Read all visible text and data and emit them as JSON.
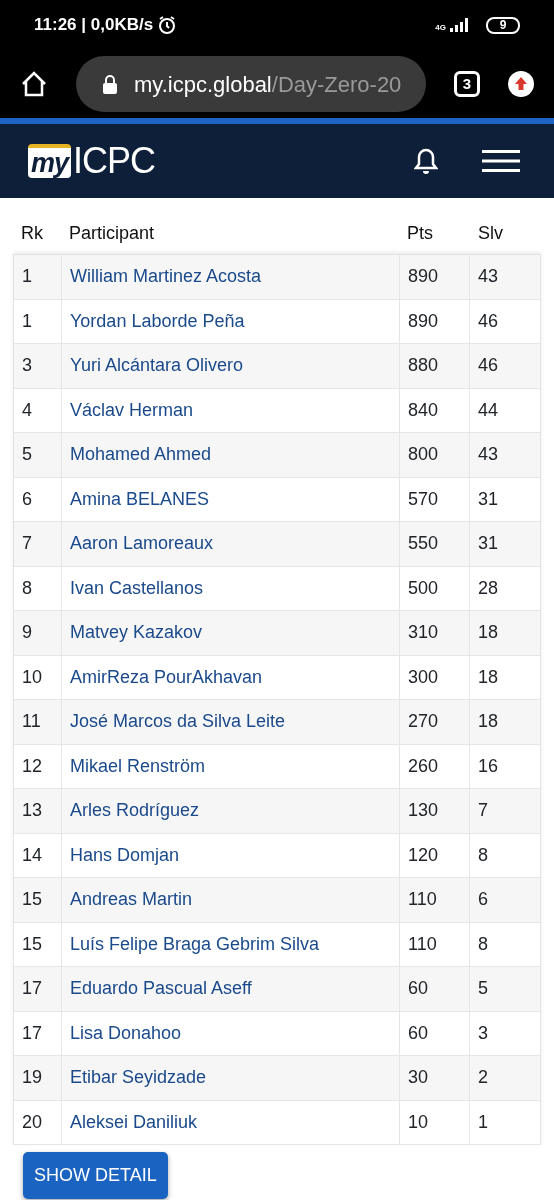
{
  "status_bar": {
    "time": "11:26",
    "separator": "|",
    "speed": "0,0KB/s",
    "network": "4G",
    "battery": "9"
  },
  "browser": {
    "url_host": "my.icpc.global",
    "url_path": "/Day-Zero-20",
    "tab_count": "3"
  },
  "header": {
    "logo_my": "my",
    "logo_text": "ICPC"
  },
  "table": {
    "columns": [
      "Rk",
      "Participant",
      "Pts",
      "Slv"
    ],
    "rows": [
      {
        "rank": "1",
        "participant": "William Martinez Acosta",
        "pts": "890",
        "slv": "43"
      },
      {
        "rank": "1",
        "participant": "Yordan Laborde Peña",
        "pts": "890",
        "slv": "46"
      },
      {
        "rank": "3",
        "participant": "Yuri Alcántara Olivero",
        "pts": "880",
        "slv": "46"
      },
      {
        "rank": "4",
        "participant": "Václav Herman",
        "pts": "840",
        "slv": "44"
      },
      {
        "rank": "5",
        "participant": "Mohamed Ahmed",
        "pts": "800",
        "slv": "43"
      },
      {
        "rank": "6",
        "participant": "Amina BELANES",
        "pts": "570",
        "slv": "31"
      },
      {
        "rank": "7",
        "participant": "Aaron Lamoreaux",
        "pts": "550",
        "slv": "31"
      },
      {
        "rank": "8",
        "participant": "Ivan Castellanos",
        "pts": "500",
        "slv": "28"
      },
      {
        "rank": "9",
        "participant": "Matvey Kazakov",
        "pts": "310",
        "slv": "18"
      },
      {
        "rank": "10",
        "participant": "AmirReza PourAkhavan",
        "pts": "300",
        "slv": "18"
      },
      {
        "rank": "11",
        "participant": "José Marcos da Silva Leite",
        "pts": "270",
        "slv": "18"
      },
      {
        "rank": "12",
        "participant": "Mikael Renström",
        "pts": "260",
        "slv": "16"
      },
      {
        "rank": "13",
        "participant": "Arles Rodríguez",
        "pts": "130",
        "slv": "7"
      },
      {
        "rank": "14",
        "participant": "Hans Domjan",
        "pts": "120",
        "slv": "8"
      },
      {
        "rank": "15",
        "participant": "Andreas Martin",
        "pts": "110",
        "slv": "6"
      },
      {
        "rank": "15",
        "participant": "Luís Felipe Braga Gebrim Silva",
        "pts": "110",
        "slv": "8"
      },
      {
        "rank": "17",
        "participant": "Eduardo Pascual Aseff",
        "pts": "60",
        "slv": "5"
      },
      {
        "rank": "17",
        "participant": "Lisa Donahoo",
        "pts": "60",
        "slv": "3"
      },
      {
        "rank": "19",
        "participant": "Etibar Seyidzade",
        "pts": "30",
        "slv": "2"
      },
      {
        "rank": "20",
        "participant": "Aleksei Daniliuk",
        "pts": "10",
        "slv": "1"
      }
    ]
  },
  "show_detail_button": "SHOW DETAIL"
}
